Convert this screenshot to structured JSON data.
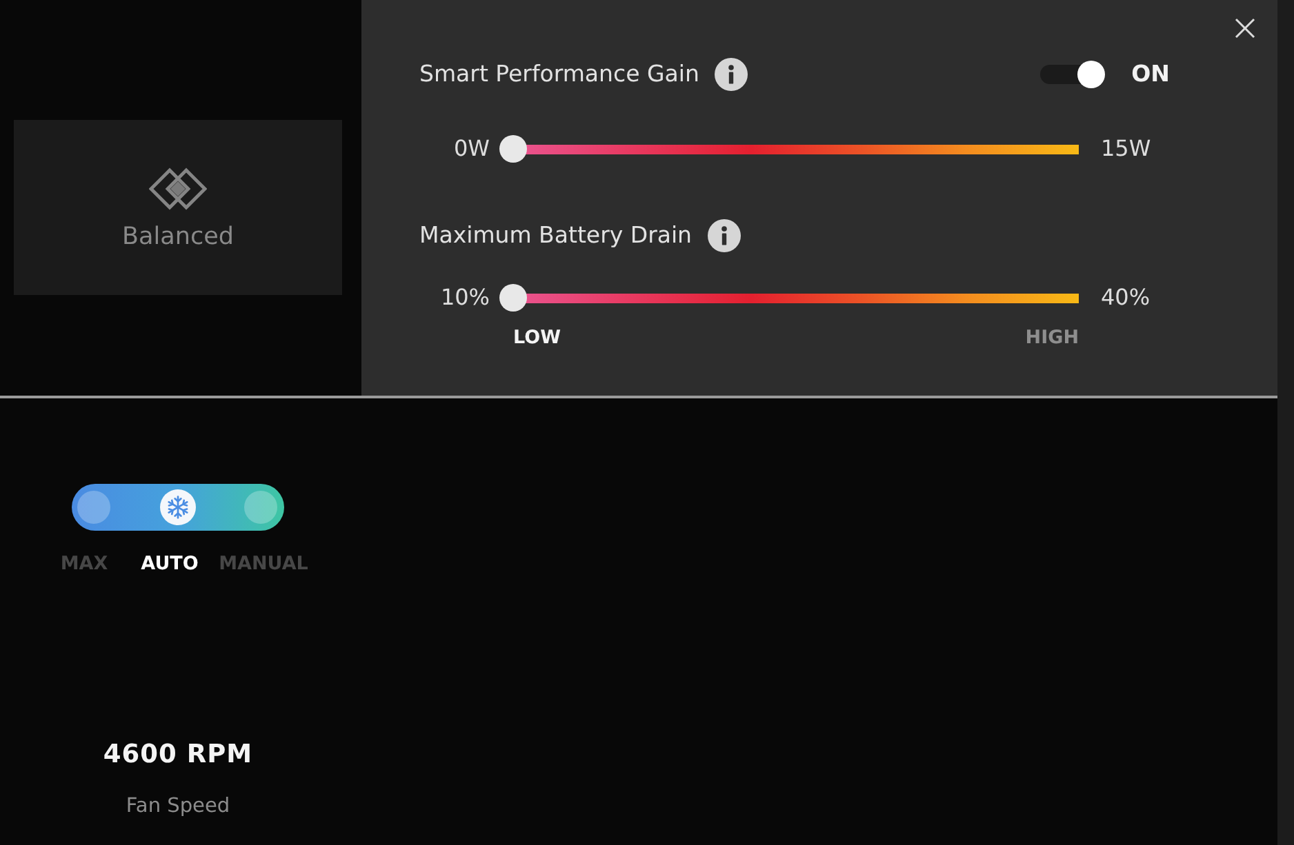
{
  "mode_card": {
    "label": "Balanced"
  },
  "panel": {
    "settings": [
      {
        "kind": "toggle_slider",
        "label": "Smart Performance Gain",
        "toggle": {
          "on": true,
          "state_label": "ON"
        },
        "slider": {
          "min_label": "0W",
          "max_label": "15W",
          "level": 0
        }
      },
      {
        "kind": "scaled_slider",
        "label": "Maximum Battery Drain",
        "slider": {
          "min_label": "10%",
          "max_label": "40%",
          "level": 0
        },
        "scale": [
          {
            "label": "LOW",
            "selected": true
          },
          {
            "label": "HIGH",
            "selected": false
          }
        ]
      }
    ]
  },
  "fan": {
    "modes": [
      {
        "label": "MAX",
        "selected": false
      },
      {
        "label": "AUTO",
        "selected": true
      },
      {
        "label": "MANUAL",
        "selected": false
      }
    ],
    "speed": "4600 RPM",
    "speed_label": "Fan Speed"
  }
}
